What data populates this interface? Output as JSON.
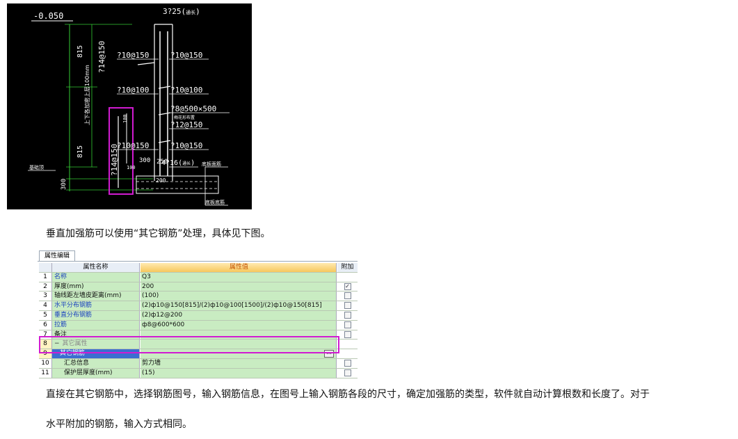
{
  "cad": {
    "labels": {
      "top_bar": "3?25(",
      "top_bar_suffix": "通长",
      "elevation": "-0.050",
      "left_dim_upper": "815",
      "left_vert_upper": "?14@150",
      "left_vert_lower": "?14@150",
      "left_dim_lower": "815",
      "left_dim_bottom": "300",
      "left_note": "基础顶",
      "h1_left": "?10@150",
      "h1_right": "?10@150",
      "h2_left": "?10@100",
      "h2_right": "?10@100",
      "tie": "?8@500×500",
      "tie_note": "梅花形布置",
      "h3_right": "?12@150",
      "h4_left": "?10@150",
      "h4_right": "?10@150",
      "bottom_bar": "4?16(",
      "bottom_bar_suffix": "通长",
      "dim_100_a": "100",
      "dim_100_b": "100",
      "dim_300": "300",
      "dim_250": "250",
      "dim_200": "200",
      "note_top_slab": "底板面筋",
      "note_bottom_slab": "底板底筋",
      "note_vertical": "上层100mm",
      "note_vertical_prefix": "上下各加密"
    },
    "colors": {
      "background": "#000000",
      "line": "#ffffff",
      "dimension": "#33cc33",
      "highlight": "#d11bd1"
    }
  },
  "text": {
    "p1": "垂直加强筋可以使用“其它钢筋”处理，具体见下图。",
    "p2": "直接在其它钢筋中，选择钢筋图号，输入钢筋信息，在图号上输入钢筋各段的尺寸，确定加强筋的类型，软件就自动计算根数和长度了。对于",
    "p3": "水平附加的钢筋，输入方式相同。"
  },
  "prop": {
    "tab_label": "属性编辑",
    "headers": {
      "name": "属性名称",
      "value": "属性值",
      "add": "附加"
    },
    "rows": [
      {
        "num": "1",
        "name": "名称",
        "value": "Q3",
        "checkbox": false,
        "checked": false,
        "blue": true
      },
      {
        "num": "2",
        "name": "厚度(mm)",
        "value": "200",
        "checkbox": true,
        "checked": true,
        "blue": false
      },
      {
        "num": "3",
        "name": "轴线距左墙皮距离(mm)",
        "value": "(100)",
        "checkbox": true,
        "checked": false,
        "blue": false
      },
      {
        "num": "4",
        "name": "水平分布钢筋",
        "value": "(2)ф10@150[815]/(2)ф10@100[1500]/(2)ф10@150[815]",
        "checkbox": true,
        "checked": false,
        "blue": true
      },
      {
        "num": "5",
        "name": "垂直分布钢筋",
        "value": "(2)ф12@200",
        "checkbox": true,
        "checked": false,
        "blue": true
      },
      {
        "num": "6",
        "name": "拉筋",
        "value": "ф8@600*600",
        "checkbox": true,
        "checked": false,
        "blue": true
      },
      {
        "num": "7",
        "name": "备注",
        "value": "",
        "checkbox": true,
        "checked": false,
        "blue": false
      },
      {
        "num": "8",
        "name": "其它属性",
        "value": "",
        "checkbox": false,
        "checked": false,
        "blue": false,
        "group": true
      },
      {
        "num": "9",
        "name": "其它钢筋",
        "value": "",
        "checkbox": false,
        "checked": false,
        "blue": false,
        "selected": true
      },
      {
        "num": "10",
        "name": "汇总信息",
        "value": "剪力墙",
        "checkbox": true,
        "checked": false,
        "blue": false
      },
      {
        "num": "11",
        "name": "保护层厚度(mm)",
        "value": "(15)",
        "checkbox": true,
        "checked": false,
        "blue": false
      }
    ],
    "group_toggle": "−",
    "check_mark": "✓",
    "ellipsis": "…"
  }
}
